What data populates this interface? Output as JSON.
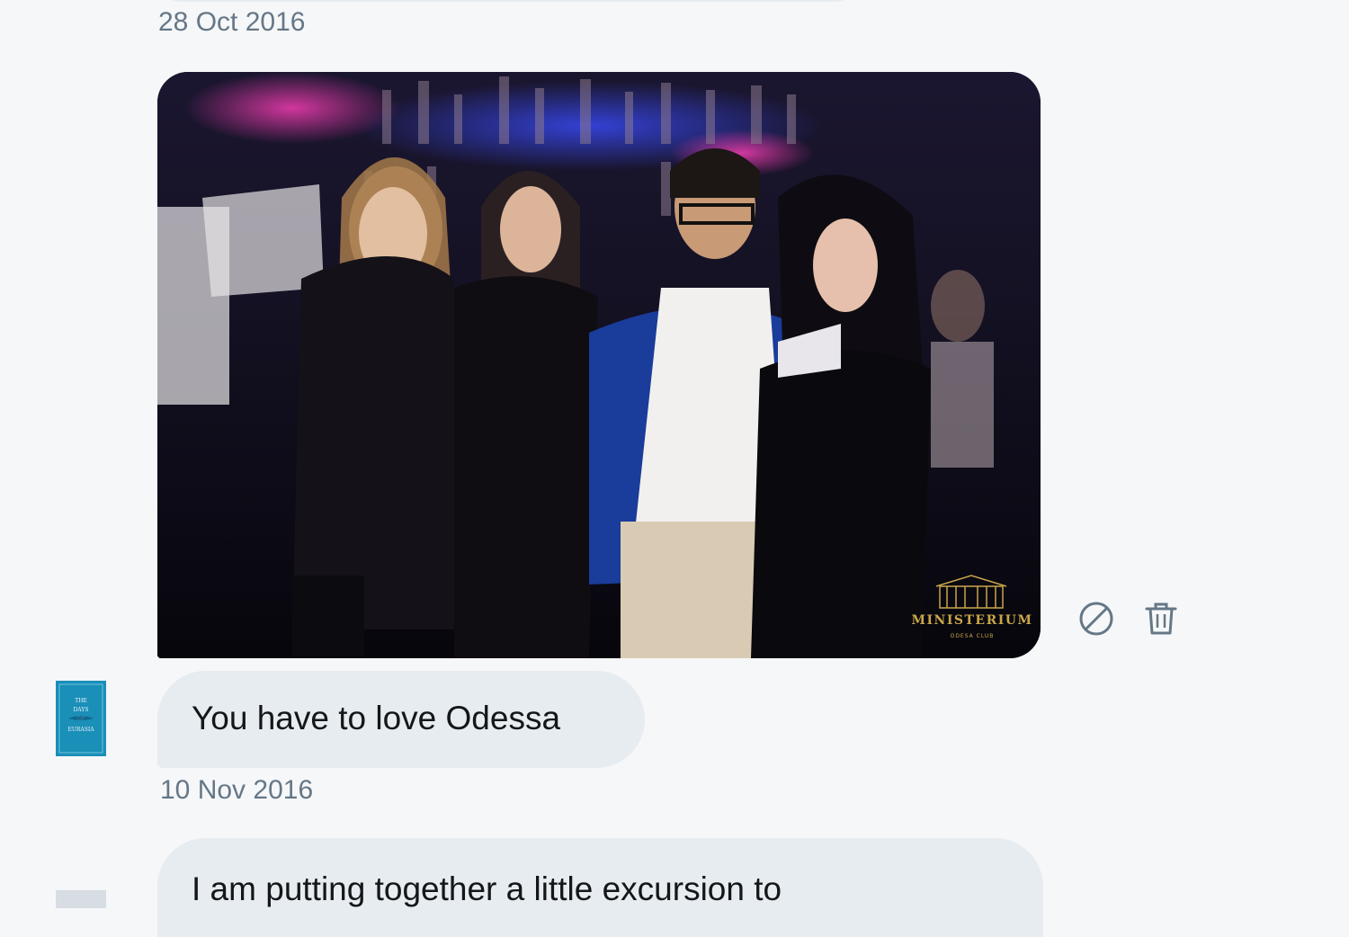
{
  "conversation": {
    "messages": [
      {
        "timestamp": "28 Oct 2016",
        "type": "image",
        "image": {
          "alt": "group photo at a nightclub",
          "watermark_text": "MINISTERIUM",
          "watermark_sub": "ODESA CLUB"
        },
        "actions": [
          {
            "name": "report-icon"
          },
          {
            "name": "delete-icon"
          }
        ]
      },
      {
        "type": "text",
        "text": "You have to love Odessa",
        "timestamp": "10 Nov 2016",
        "avatar": {
          "book_title_lines": [
            "THE",
            "DAYS",
            "OF",
            "EURASIA"
          ]
        }
      },
      {
        "type": "text",
        "text": "I am putting together a little excursion to"
      }
    ]
  },
  "colors": {
    "bubble_bg": "#e6ecf0",
    "timestamp": "#657786",
    "page_bg": "#f6f7f9",
    "icon": "#657786",
    "avatar_bg": "#1a8fb8"
  }
}
